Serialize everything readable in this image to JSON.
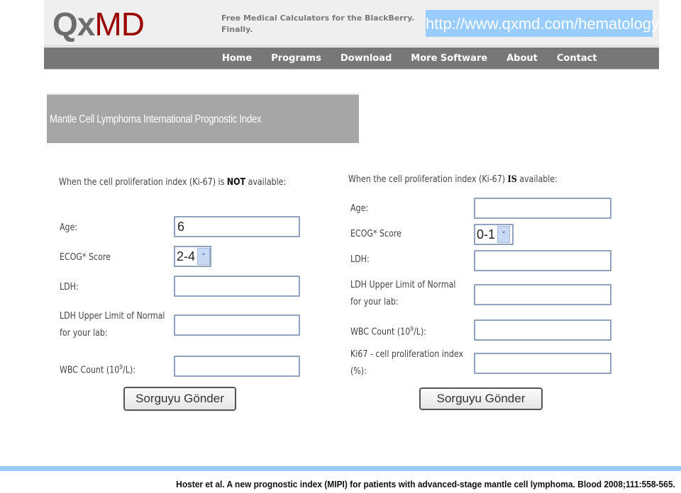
{
  "header": {
    "logo_q": "Qx",
    "logo_md": "MD",
    "tagline_line1": "Free Medical Calculators for the BlackBerry.",
    "tagline_line2": "Finally.",
    "url": "http://www.qxmd.com/hematology"
  },
  "nav": {
    "items": [
      "Home",
      "Programs",
      "Download",
      "More Software",
      "About",
      "Contact"
    ]
  },
  "page_title": "Mantle Cell Lymphoma International Prognostic Index",
  "form_without_ki67": {
    "heading_prefix": "When the cell proliferation index (Ki-67) is ",
    "heading_bold": "NOT",
    "heading_suffix": " available:",
    "age_label": "Age:",
    "age_value": "6",
    "ecog_label": "ECOG* Score",
    "ecog_value": "2-4",
    "ldh_label": "LDH:",
    "ldh_value": "",
    "ldh_uln_label_line1": "LDH Upper Limit of Normal",
    "ldh_uln_label_line2": "for your lab:",
    "ldh_uln_value": "",
    "wbc_label_prefix": "WBC Count (10",
    "wbc_label_sup": "9",
    "wbc_label_suffix": "/L):",
    "wbc_value": "",
    "submit_label": "Sorguyu Gönder"
  },
  "form_with_ki67": {
    "heading_prefix": "When the cell proliferation index (Ki-67) ",
    "heading_bold": "IS",
    "heading_suffix": " available:",
    "age_label": "Age:",
    "age_value": "",
    "ecog_label": "ECOG* Score",
    "ecog_value": "0-1",
    "ldh_label": "LDH:",
    "ldh_value": "",
    "ldh_uln_label_line1": "LDH Upper Limit of Normal",
    "ldh_uln_label_line2": "for your lab:",
    "ldh_uln_value": "",
    "wbc_label_prefix": "WBC Count (10",
    "wbc_label_sup": "9",
    "wbc_label_suffix": "/L):",
    "wbc_value": "",
    "ki67_label_line1": "Ki67 - cell proliferation index",
    "ki67_label_line2": "(%):",
    "ki67_value": "",
    "submit_label": "Sorguyu Gönder"
  },
  "footer": {
    "citation": "Hoster et al. A new prognostic index (MIPI) for patients with advanced-stage mantle cell lymphoma. Blood 2008;111:558-565."
  },
  "icons": {
    "dropdown_arrow": "˅"
  }
}
